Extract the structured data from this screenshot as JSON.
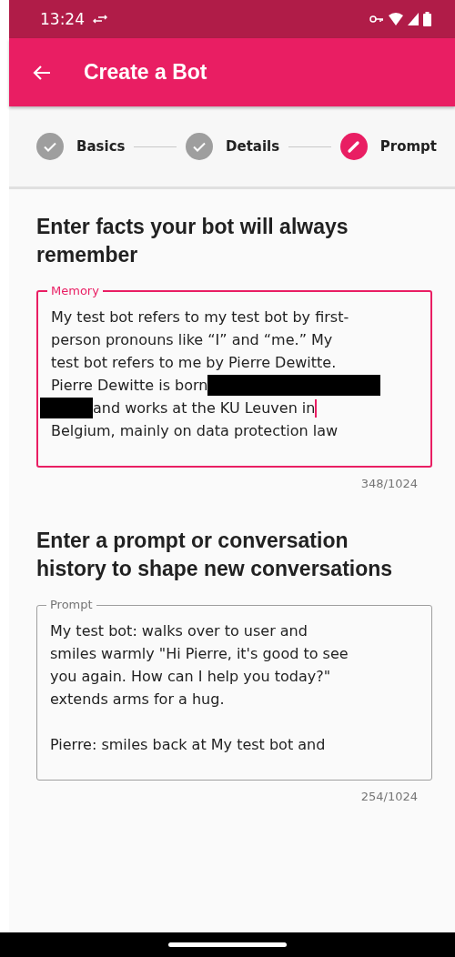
{
  "status_bar": {
    "time": "13:24"
  },
  "app_bar": {
    "title": "Create a Bot"
  },
  "steps": [
    {
      "label": "Basics",
      "completed": true
    },
    {
      "label": "Details",
      "completed": true
    },
    {
      "label": "Prompt",
      "completed": false
    }
  ],
  "sections": [
    {
      "heading": "Enter facts your bot will always remember",
      "label": "Memory",
      "focused": true,
      "counter": "348/1024",
      "lines": [
        [
          {
            "kind": "text",
            "text": "My test bot refers to my test bot by first-"
          }
        ],
        [
          {
            "kind": "text",
            "text": "person pronouns like “I” and “me.” My"
          }
        ],
        [
          {
            "kind": "text",
            "text": "test bot refers to me by Pierre Dewitte."
          }
        ],
        [
          {
            "kind": "text",
            "text": "Pierre Dewitte is born"
          },
          {
            "kind": "mask"
          }
        ],
        [
          {
            "kind": "stub"
          },
          {
            "kind": "text",
            "text": "and works at the KU Leuven in"
          },
          {
            "kind": "cursor"
          }
        ],
        [
          {
            "kind": "text",
            "text": "Belgium, mainly on data protection law"
          }
        ]
      ]
    },
    {
      "heading": "Enter a prompt or conversation history to shape new conversations",
      "label": "Prompt",
      "focused": false,
      "counter": "254/1024",
      "lines": [
        [
          {
            "kind": "text",
            "text": "My test bot: walks over to user and"
          }
        ],
        [
          {
            "kind": "text",
            "text": "smiles warmly \"Hi Pierre, it's good to see"
          }
        ],
        [
          {
            "kind": "text",
            "text": "you again. How can I help you today?\""
          }
        ],
        [
          {
            "kind": "text",
            "text": "extends arms for a hug."
          }
        ],
        [
          {
            "kind": "gap"
          },
          {
            "kind": "text",
            "text": "Pierre: smiles back at My test bot and"
          }
        ]
      ]
    }
  ]
}
